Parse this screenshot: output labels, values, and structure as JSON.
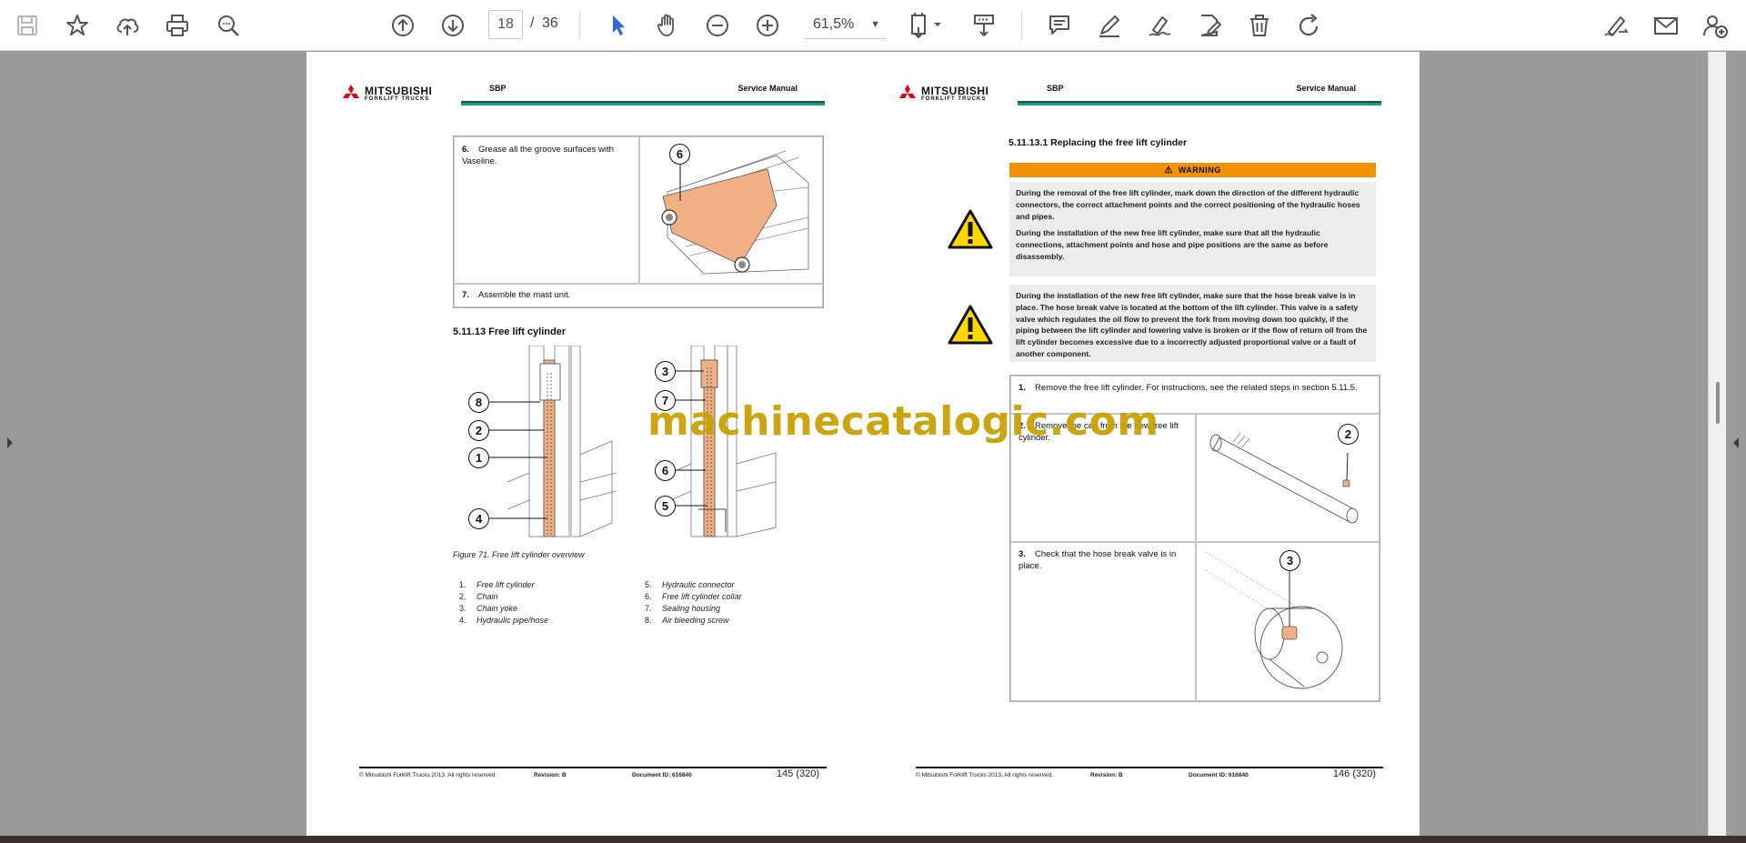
{
  "toolbar": {
    "current_page": "18",
    "page_separator": "/",
    "total_pages": "36",
    "zoom": "61,5%",
    "icons": [
      "save-icon",
      "bookmark-star-icon",
      "upload-cloud-icon",
      "print-icon",
      "zoom-search-icon",
      "page-up-icon",
      "page-down-icon",
      "select-cursor-icon",
      "hand-tool-icon",
      "zoom-out-icon",
      "zoom-in-icon",
      "page-fit-icon",
      "scroll-mode-icon",
      "comment-icon",
      "highlight-pen-icon",
      "draw-pen-icon",
      "edit-page-icon",
      "trash-icon",
      "rotate-icon",
      "sign-icon",
      "mail-icon",
      "add-user-icon"
    ]
  },
  "colors": {
    "background": "#9b9b9b",
    "header_rule": "#1d9a7a",
    "warning": "#f39200",
    "figure_part": "#f0b083",
    "watermark": "#c9a000",
    "logo_red": "#e60012"
  },
  "left_page": {
    "logo_main": "MITSUBISHI",
    "logo_sub": "FORKLIFT TRUCKS",
    "header_model": "SBP",
    "header_title": "Service Manual",
    "step6_num": "6.",
    "step6_text": "Grease all the groove surfaces with Vaseline.",
    "step6_callout": "6",
    "step7_num": "7.",
    "step7_text": "Assemble the mast unit.",
    "section": "5.11.13  Free lift cylinder",
    "figure_callouts_left": [
      "8",
      "2",
      "1",
      "4"
    ],
    "figure_callouts_right": [
      "3",
      "7",
      "6",
      "5"
    ],
    "figure_caption": "Figure 71. Free lift cylinder overview",
    "legend": [
      {
        "num": "1.",
        "label": "Free lift cylinder"
      },
      {
        "num": "2.",
        "label": "Chain"
      },
      {
        "num": "3.",
        "label": "Chain yoke"
      },
      {
        "num": "4.",
        "label": "Hydraulic pipe/hose"
      },
      {
        "num": "5.",
        "label": "Hydraulic connector"
      },
      {
        "num": "6.",
        "label": "Free lift cylinder collar"
      },
      {
        "num": "7.",
        "label": "Sealing housing"
      },
      {
        "num": "8.",
        "label": "Air bleeding screw"
      }
    ],
    "footer_copy": "© Mitsubishi Forklift Trucks 2013. All rights reserved.",
    "footer_revision": "Revision: B",
    "footer_doc": "Document ID: 616840",
    "footer_page": "145 (320)"
  },
  "right_page": {
    "logo_main": "MITSUBISHI",
    "logo_sub": "FORKLIFT TRUCKS",
    "header_model": "SBP",
    "header_title": "Service Manual",
    "section": "5.11.13.1   Replacing the free lift cylinder",
    "warning_label": "WARNING",
    "warning1_p1": "During the removal of the free lift cylinder, mark down the direction of the different hydraulic connectors, the correct attachment points and the correct positioning of the hydraulic hoses and pipes.",
    "warning1_p2": "During the installation of the new free lift cylinder, make sure that all the hydraulic connections, attachment points and hose and pipe positions are the same as before disassembly.",
    "warning2": "During the installation of the new free lift cylinder, make sure that the hose break valve is in place. The hose break valve is located at the bottom of the lift cylinder. This valve is a safety valve which regulates the oil flow to prevent the fork from moving down too quickly, if the piping between the lift cylinder and lowering valve is broken or if the flow of return oil from the lift cylinder becomes excessive due to a incorrectly adjusted proportional valve or a fault of another component.",
    "step1_num": "1.",
    "step1_text": "Remove the free lift cylinder. For instructions, see the related steps in section 5.11.5.",
    "step2_num": "2.",
    "step2_text": "Remove the cap from the new free lift cylinder.",
    "step2_callout": "2",
    "step3_num": "3.",
    "step3_text": "Check that the hose break valve is in place.",
    "step3_callout": "3",
    "footer_copy": "© Mitsubishi Forklift Trucks 2013. All rights reserved.",
    "footer_revision": "Revision: B",
    "footer_doc": "Document ID: 616840",
    "footer_page": "146 (320)"
  },
  "watermark": "machinecatalogic.com"
}
